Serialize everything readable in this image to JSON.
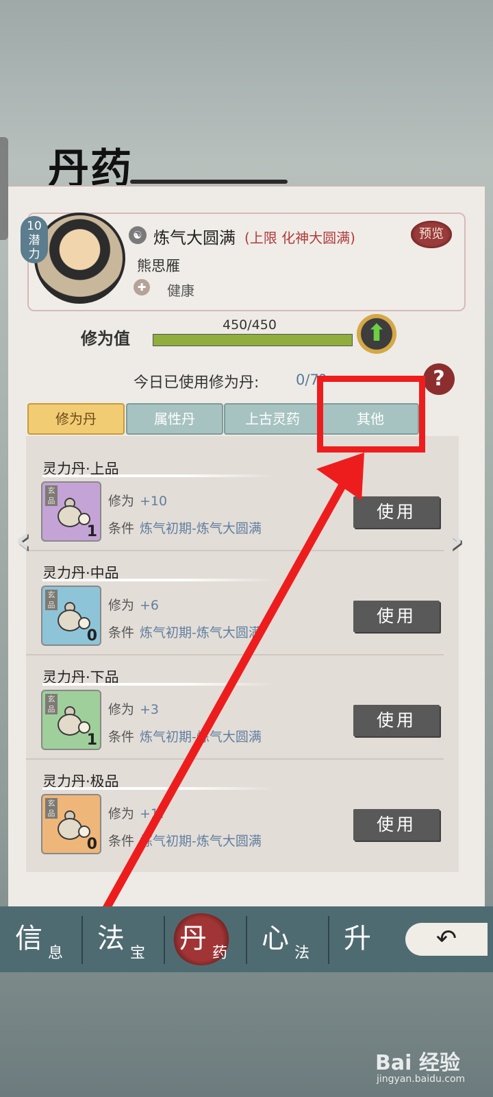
{
  "header": {
    "title": "丹药"
  },
  "profile": {
    "potential_value": "10",
    "potential_label": "潜力",
    "realm": "炼气大圆满",
    "realm_limit": "(上限 化神大圆满)",
    "preview_label": "预览",
    "name": "熊思雁",
    "status": "健康"
  },
  "cultivation": {
    "label": "修为值",
    "text": "450/450",
    "progress_percent": 100
  },
  "daily": {
    "label": "今日已使用修为丹:",
    "value": "0/7?"
  },
  "tabs": [
    {
      "label": "修为丹",
      "active": true
    },
    {
      "label": "属性丹",
      "active": false
    },
    {
      "label": "上古灵药",
      "active": false
    },
    {
      "label": "其他",
      "active": false
    }
  ],
  "items": [
    {
      "name": "灵力丹·上品",
      "grade": "玄品",
      "count": "1",
      "effect_label": "修为",
      "effect_value": "+10",
      "cond_label": "条件",
      "cond_value": "炼气初期-炼气大圆满",
      "button": "使用",
      "color": "#c4a3d6"
    },
    {
      "name": "灵力丹·中品",
      "grade": "玄品",
      "count": "0",
      "effect_label": "修为",
      "effect_value": "+6",
      "cond_label": "条件",
      "cond_value": "炼气初期-炼气大圆满",
      "button": "使用",
      "color": "#8ec4d8"
    },
    {
      "name": "灵力丹·下品",
      "grade": "玄品",
      "count": "1",
      "effect_label": "修为",
      "effect_value": "+3",
      "cond_label": "条件",
      "cond_value": "炼气初期-炼气大圆满",
      "button": "使用",
      "color": "#9fcf9b"
    },
    {
      "name": "灵力丹·极品",
      "grade": "玄品",
      "count": "0",
      "effect_label": "修为",
      "effect_value": "+1?",
      "cond_label": "条件",
      "cond_value": "炼气初期-炼气大圆满",
      "button": "使用",
      "color": "#efb679"
    }
  ],
  "nav": [
    {
      "big": "信",
      "small": "息"
    },
    {
      "big": "法",
      "small": "宝"
    },
    {
      "big": "丹",
      "small": "药"
    },
    {
      "big": "心",
      "small": "法"
    },
    {
      "big": "升",
      "small": ""
    }
  ],
  "watermark": {
    "brand": "Bai 经验",
    "url": "jingyan.baidu.com"
  }
}
